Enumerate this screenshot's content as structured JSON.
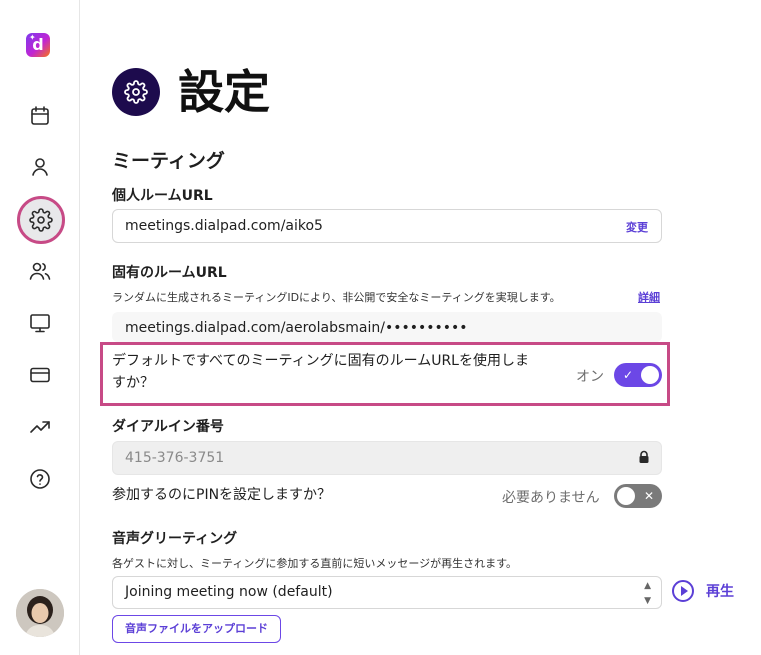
{
  "app": {
    "logo_letter": "d"
  },
  "page": {
    "title": "設定"
  },
  "section": {
    "title": "ミーティング"
  },
  "personal_room": {
    "label": "個人ルームURL",
    "value": "meetings.dialpad.com/aiko5",
    "change_label": "変更"
  },
  "unique_room": {
    "label": "固有のルームURL",
    "description": "ランダムに生成されるミーティングIDにより、非公開で安全なミーティングを実現します。",
    "details_label": "詳細",
    "value": "meetings.dialpad.com/aerolabsmain/••••••••••",
    "default_question_line1": "デフォルトですべてのミーティングに固有のルームURLを使用しま",
    "default_question_line2": "すか？",
    "toggle_state_label": "オン",
    "toggle_on": true
  },
  "dialin": {
    "label": "ダイアルイン番号",
    "value": "415-376-3751"
  },
  "pin": {
    "question": "参加するのにPINを設定しますか？",
    "state_label": "必要ありません",
    "toggle_on": false
  },
  "greeting": {
    "label": "音声グリーティング",
    "description": "各ゲストに対し、ミーティングに参加する直前に短いメッセージが再生されます。",
    "selected_option": "Joining meeting now (default)",
    "play_label": "再生",
    "upload_label": "音声ファイルをアップロード"
  },
  "colors": {
    "accent": "#6c47e6",
    "highlight": "#c74a86",
    "title_icon_bg": "#1d0b4d"
  }
}
